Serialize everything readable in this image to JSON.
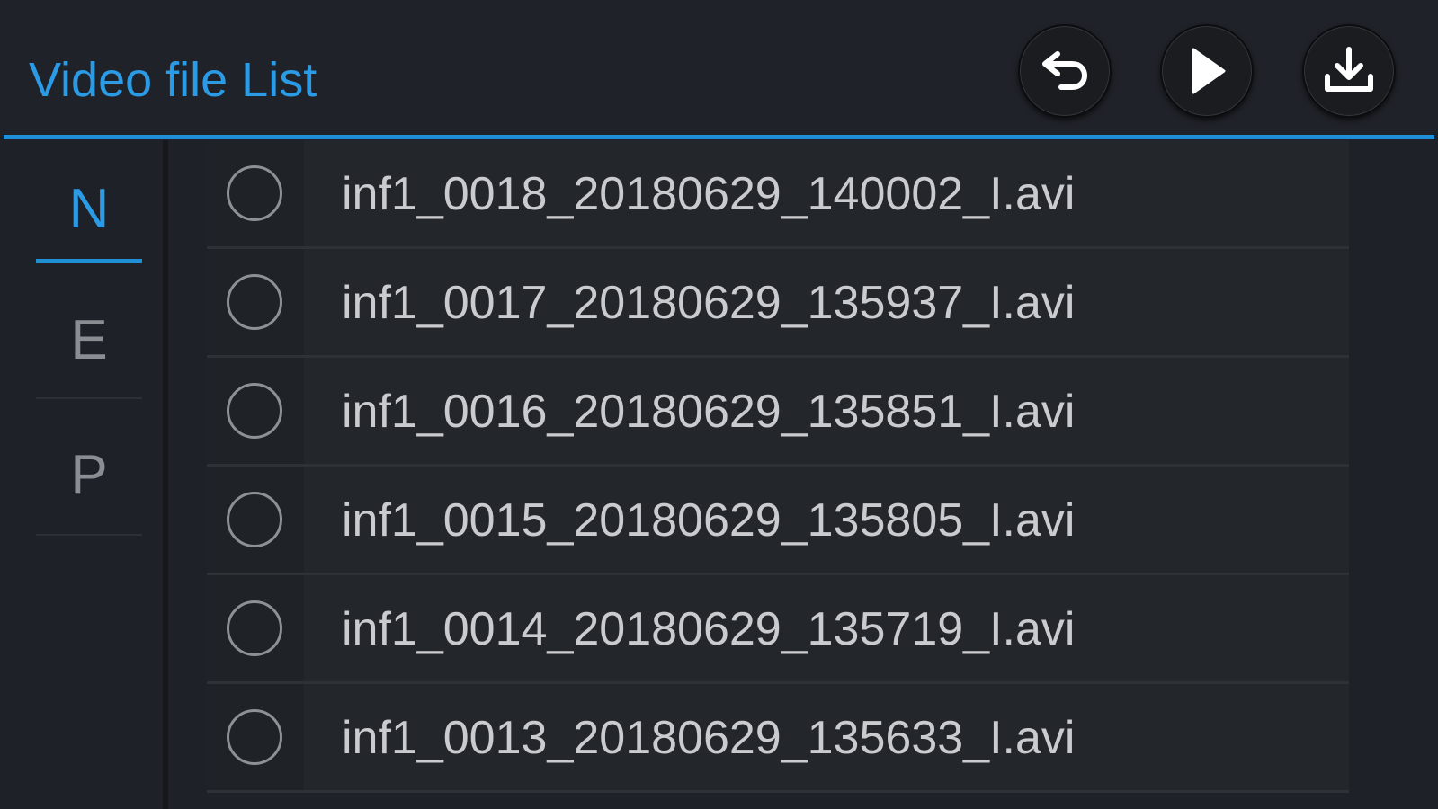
{
  "header": {
    "title": "Video file List",
    "buttons": {
      "back_icon": "return-arrow-icon",
      "play_icon": "play-icon",
      "download_icon": "download-icon"
    }
  },
  "tabs": [
    {
      "label": "N",
      "active": true
    },
    {
      "label": "E",
      "active": false
    },
    {
      "label": "P",
      "active": false
    }
  ],
  "files": [
    "inf1_0018_20180629_140002_I.avi",
    "inf1_0017_20180629_135937_I.avi",
    "inf1_0016_20180629_135851_I.avi",
    "inf1_0015_20180629_135805_I.avi",
    "inf1_0014_20180629_135719_I.avi",
    "inf1_0013_20180629_135633_I.avi"
  ],
  "colors": {
    "accent": "#2b9be6",
    "background": "#1e2127",
    "row_background": "#23262b",
    "text": "#c9cbce",
    "inactive_tab": "#8a8d92"
  }
}
